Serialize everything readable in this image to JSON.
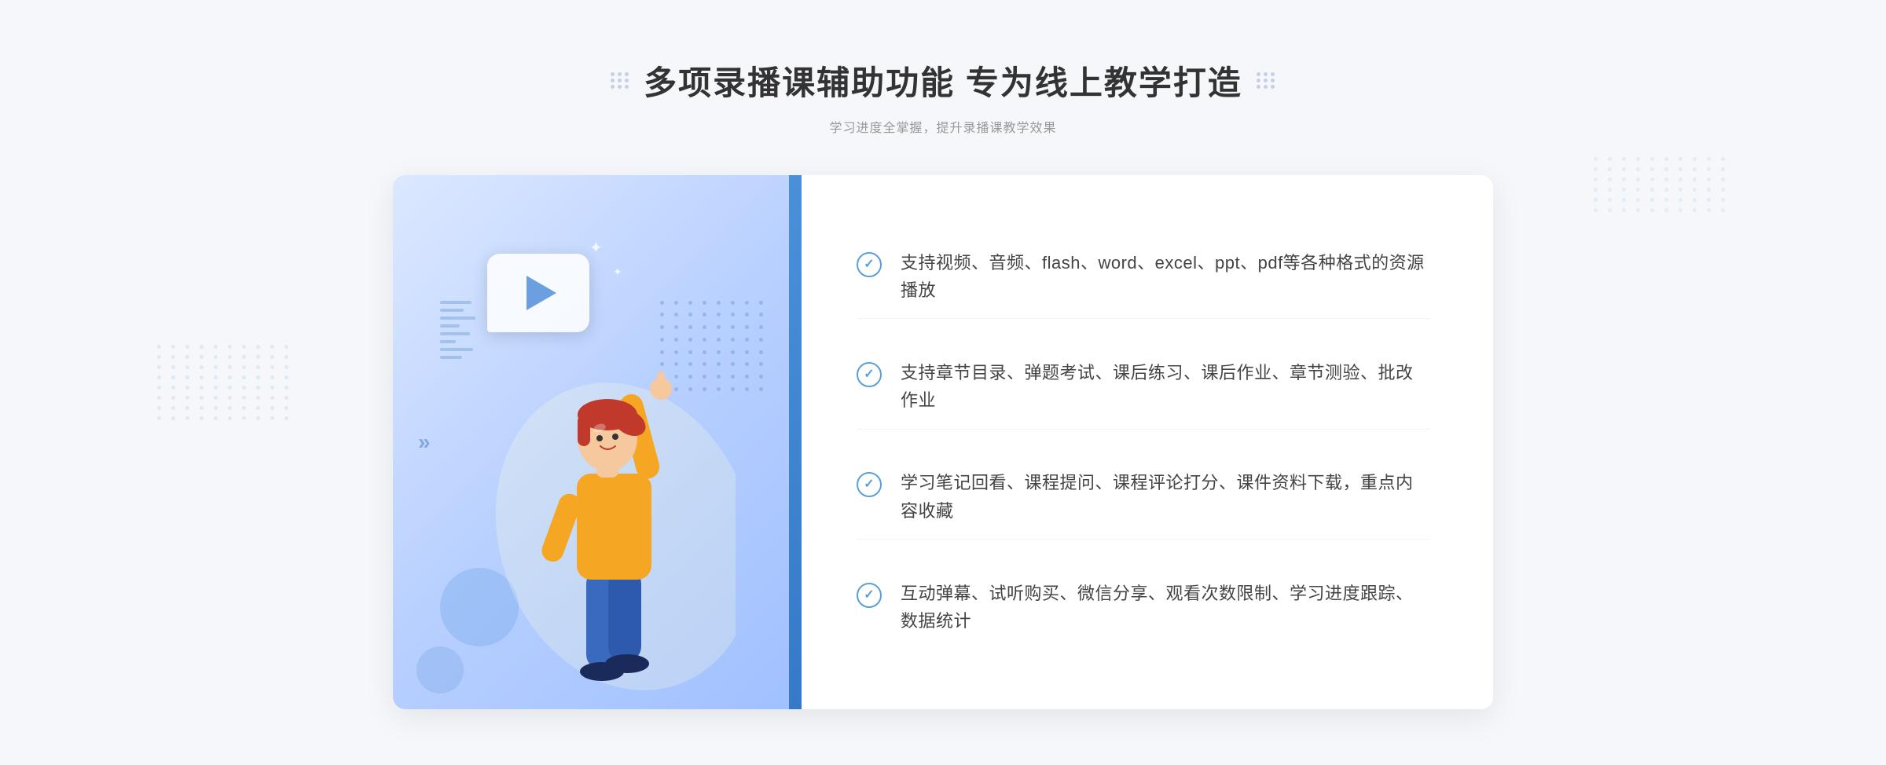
{
  "header": {
    "title": "多项录播课辅助功能 专为线上教学打造",
    "subtitle": "学习进度全掌握，提升录播课教学效果",
    "dot_grid_label": "decoration-dots"
  },
  "features": [
    {
      "id": 1,
      "text": "支持视频、音频、flash、word、excel、ppt、pdf等各种格式的资源播放"
    },
    {
      "id": 2,
      "text": "支持章节目录、弹题考试、课后练习、课后作业、章节测验、批改作业"
    },
    {
      "id": 3,
      "text": "学习笔记回看、课程提问、课程评论打分、课件资料下载，重点内容收藏"
    },
    {
      "id": 4,
      "text": "互动弹幕、试听购买、微信分享、观看次数限制、学习进度跟踪、数据统计"
    }
  ],
  "illustration": {
    "play_label": "play-button",
    "chevron_label": "»"
  },
  "colors": {
    "accent": "#4a90d9",
    "text_dark": "#333333",
    "text_muted": "#999999",
    "check_color": "#5a9fd8",
    "bg_light": "#f5f7fa"
  }
}
